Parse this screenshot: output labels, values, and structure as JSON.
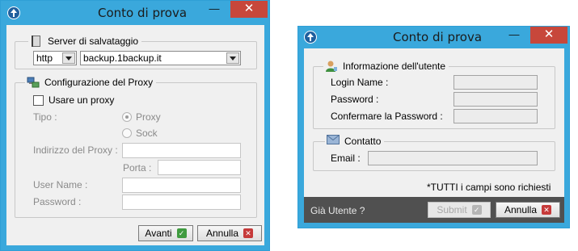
{
  "left_dialog": {
    "title": "Conto di prova",
    "minimize_label": "—",
    "close_label": "✕",
    "server_group": {
      "legend": "Server di salvataggio",
      "protocol_value": "http",
      "host_value": "backup.1backup.it"
    },
    "proxy_group": {
      "legend": "Configurazione del Proxy",
      "use_proxy_label": "Usare un proxy",
      "type_label": "Tipo :",
      "proxy_option": "Proxy",
      "sock_option": "Sock",
      "address_label": "Indirizzo del Proxy :",
      "port_label": "Porta :",
      "username_label": "User Name :",
      "password_label": "Password :"
    },
    "next_button": "Avanti",
    "cancel_button": "Annulla"
  },
  "right_dialog": {
    "title": "Conto di prova",
    "minimize_label": "—",
    "close_label": "✕",
    "user_group": {
      "legend": "Informazione dell'utente",
      "login_label": "Login Name :",
      "password_label": "Password :",
      "confirm_label": "Confermare la Password :"
    },
    "contact_group": {
      "legend": "Contatto",
      "email_label": "Email :"
    },
    "required_note": "*TUTTI i campi sono richiesti",
    "existing_user_label": "Già Utente ?",
    "submit_button": "Submit",
    "cancel_button": "Annulla"
  },
  "colors": {
    "window_frame": "#3aa8dc",
    "close_button": "#c7473b",
    "footer": "#505050"
  }
}
